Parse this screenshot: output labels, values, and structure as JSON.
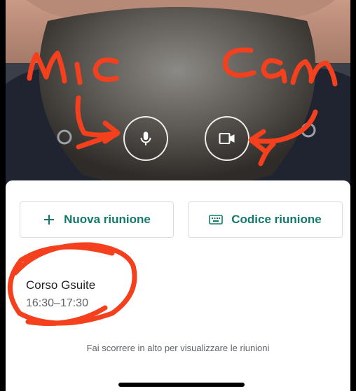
{
  "controls": {
    "mic_icon": "microphone-icon",
    "camera_icon": "video-camera-icon"
  },
  "actions": {
    "new_meeting_label": "Nuova riunione",
    "new_meeting_icon": "plus-icon",
    "meeting_code_label": "Codice riunione",
    "meeting_code_icon": "keyboard-icon"
  },
  "meeting": {
    "title": "Corso Gsuite",
    "time": "16:30–17:30"
  },
  "hint": "Fai scorrere in alto per visualizzare le riunioni",
  "annotations": {
    "mic_label": "mic",
    "cam_label": "cam"
  },
  "colors": {
    "accent": "#137a6b",
    "annotation": "#f5401e",
    "camera_bg": "#2a2d33"
  }
}
